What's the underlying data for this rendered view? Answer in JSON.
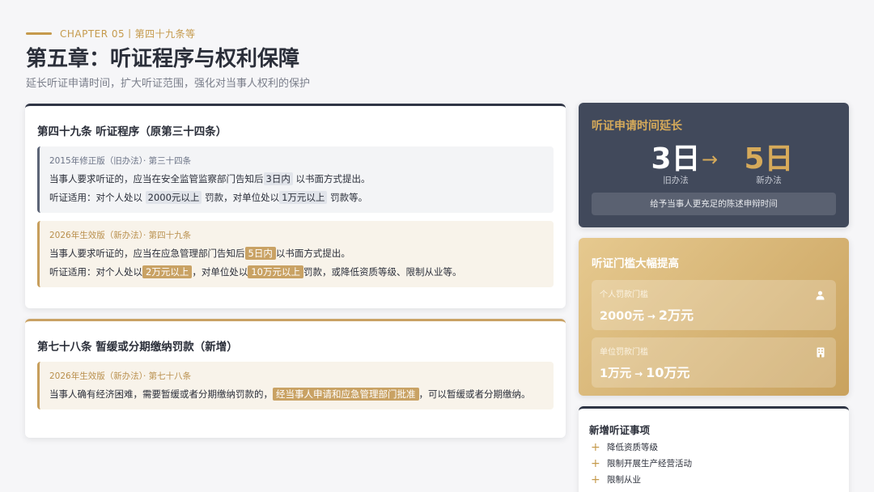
{
  "header": {
    "eyebrow": "CHAPTER 05丨第四十九条等",
    "title": "第五章：听证程序与权利保障",
    "subtitle": "延长听证申请时间，扩大听证范围，强化对当事人权利的保护"
  },
  "article49": {
    "title": "第四十九条 听证程序（原第三十四条）",
    "old": {
      "label": "2015年修正版（旧办法）· 第三十四条",
      "line1_pre": "当事人要求听证的，应当在安全监管监察部门告知后",
      "line1_hl": "3日内",
      "line1_post": "以书面方式提出。",
      "line2_pre": "听证适用：对个人处以",
      "line2_hl1": "2000元以上",
      "line2_mid": "罚款，对单位处以",
      "line2_hl2": "1万元以上",
      "line2_post": "罚款等。"
    },
    "new": {
      "label": "2026年生效版（新办法）· 第四十九条",
      "line1_pre": "当事人要求听证的，应当在应急管理部门告知后",
      "line1_hl": "5日内",
      "line1_post": "以书面方式提出。",
      "line2_pre": "听证适用：对个人处以",
      "line2_hl1": "2万元以上",
      "line2_mid": "，对单位处以",
      "line2_hl2": "10万元以上",
      "line2_post": "罚款，或降低资质等级、限制从业等。"
    }
  },
  "article78": {
    "title": "第七十八条 暂缓或分期缴纳罚款（新增）",
    "label": "2026年生效版（新办法）· 第七十八条",
    "text_pre": "当事人确有经济困难，需要暂缓或者分期缴纳罚款的，",
    "text_hl": "经当事人申请和应急管理部门批准",
    "text_post": "，可以暂缓或者分期缴纳。"
  },
  "time_card": {
    "title": "听证申请时间延长",
    "old_value": "3日",
    "old_caption": "旧办法",
    "new_value": "5日",
    "new_caption": "新办法",
    "note": "给予当事人更充足的陈述申辩时间"
  },
  "threshold_card": {
    "title": "听证门槛大幅提高",
    "items": [
      {
        "label": "个人罚款门槛",
        "from": "2000元",
        "to": "2万元",
        "icon": "user-icon"
      },
      {
        "label": "单位罚款门槛",
        "from": "1万元",
        "to": "10万元",
        "icon": "building-icon"
      }
    ]
  },
  "new_items": {
    "title": "新增听证事项",
    "items": [
      "降低资质等级",
      "限制开展生产经营活动",
      "限制从业"
    ]
  },
  "colors": {
    "accent_gold": "#c59a4c",
    "dark_panel": "#41495b",
    "highlight_new": "#c9a264"
  }
}
